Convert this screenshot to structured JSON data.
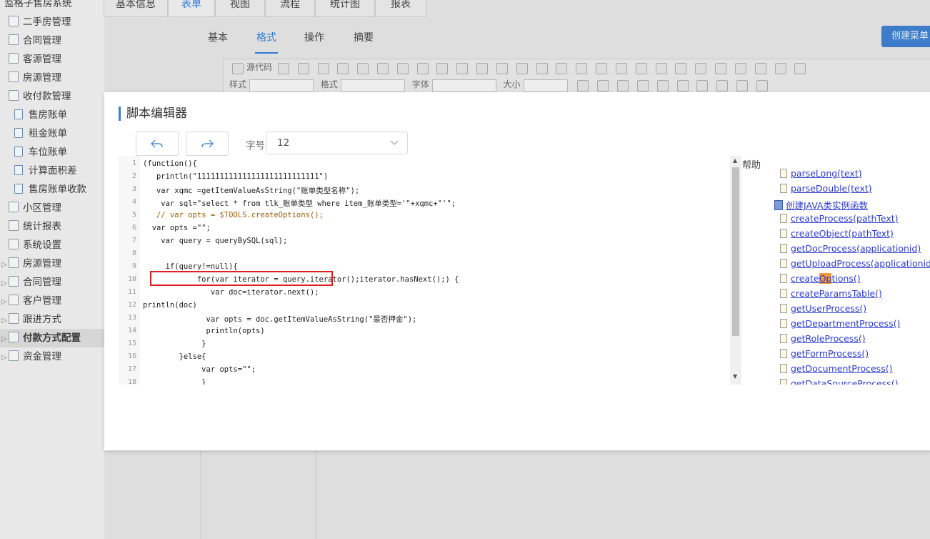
{
  "app": {
    "system_title": "监格子售房系统",
    "sidebar": [
      {
        "label": "二手房管理",
        "level": 0
      },
      {
        "label": "合同管理",
        "level": 0
      },
      {
        "label": "客源管理",
        "level": 0
      },
      {
        "label": "房源管理",
        "level": 0
      },
      {
        "label": "收付款管理",
        "level": 0
      },
      {
        "label": "售房账单",
        "level": 1
      },
      {
        "label": "租金账单",
        "level": 1
      },
      {
        "label": "车位账单",
        "level": 1
      },
      {
        "label": "计算面积差",
        "level": 1
      },
      {
        "label": "售房账单收款",
        "level": 1
      },
      {
        "label": "小区管理",
        "level": 0
      },
      {
        "label": "统计报表",
        "level": 0
      },
      {
        "label": "系统设置",
        "level": 0
      },
      {
        "label": "房源管理",
        "level": 1
      },
      {
        "label": "合同管理",
        "level": 1
      },
      {
        "label": "客户管理",
        "level": 1
      },
      {
        "label": "跟进方式",
        "level": 1
      },
      {
        "label": "付款方式配置",
        "level": 1,
        "active": true
      },
      {
        "label": "资金管理",
        "level": 1
      }
    ],
    "outer_tabs": [
      "基本信息",
      "表单",
      "视图",
      "流程",
      "统计图",
      "报表"
    ],
    "outer_tab_active": "表单",
    "inner_tabs": [
      "基本",
      "格式",
      "操作",
      "摘要"
    ],
    "inner_tab_active": "格式",
    "create_menu_label": "创建菜单",
    "toolbar": {
      "source_label": "源代码",
      "style_label": "样式",
      "format_label": "格式",
      "font_label": "字体",
      "size_label": "大小"
    }
  },
  "modal": {
    "title": "脚本编辑器",
    "font_size_label": "字号",
    "font_size_value": "12",
    "code_lines": [
      "(function(){",
      "   println(\"111111111111111111111111111\")",
      "   var xqmc =getItemValueAsString(\"账单类型名称\");",
      "    var sql=\"select * from tlk_账单类型 where item_账单类型='\"+xqmc+\"'\";",
      "   // var opts = $TOOLS.createOptions();",
      "  var opts =\"\";",
      "    var query = queryBySQL(sql);",
      "",
      "     if(query!=null){",
      "            for(var iterator = query.iterator();iterator.hasNext();) {",
      "               var doc=iterator.next();",
      "println(doc)",
      "              var opts = doc.getItemValueAsString(\"是否押金\");",
      "              println(opts)",
      "             }",
      "        }else{",
      "             var opts=\"\";",
      "             }"
    ],
    "line_numbers": [
      "1",
      "2",
      "3",
      "4",
      "5",
      "6",
      "7",
      "8",
      "9",
      "10",
      "11",
      "12",
      "13",
      "14",
      "15",
      "16",
      "17",
      "18"
    ],
    "help": {
      "title": "帮助",
      "items": [
        {
          "label": "parseLong(text)",
          "type": "page"
        },
        {
          "label": "parseDouble(text)",
          "type": "page"
        },
        {
          "label": "创建JAVA类实例函数",
          "type": "folder"
        },
        {
          "label": "createProcess(pathText)",
          "type": "page"
        },
        {
          "label": "createObject(pathText)",
          "type": "page"
        },
        {
          "label": "getDocProcess(applicationid)",
          "type": "page"
        },
        {
          "label": "getUploadProcess(applicationid)",
          "type": "page"
        },
        {
          "label": "createOptions()",
          "type": "page",
          "highlight": "Op"
        },
        {
          "label": "createParamsTable()",
          "type": "page"
        },
        {
          "label": "getUserProcess()",
          "type": "page"
        },
        {
          "label": "getDepartmentProcess()",
          "type": "page"
        },
        {
          "label": "getRoleProcess()",
          "type": "page"
        },
        {
          "label": "getFormProcess()",
          "type": "page"
        },
        {
          "label": "getDocumentProcess()",
          "type": "page"
        },
        {
          "label": "getDataSourceProcess()",
          "type": "page"
        }
      ]
    }
  }
}
